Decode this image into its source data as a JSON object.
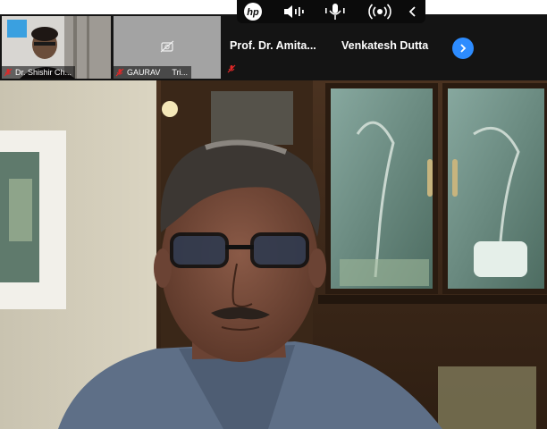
{
  "hp_toolbar": {
    "logo": "hp",
    "buttons": [
      {
        "icon": "speaker-icon"
      },
      {
        "icon": "microphone-icon"
      },
      {
        "icon": "broadcast-icon"
      },
      {
        "icon": "chevron-left-icon"
      }
    ]
  },
  "participants": [
    {
      "name": "Dr. Shishir Ch...",
      "muted": true,
      "video": true
    },
    {
      "name": "GAURAV",
      "subtitle": "Tri...",
      "muted": true,
      "video": false
    },
    {
      "name": "Prof. Dr. Amita...",
      "muted": true,
      "video": false
    },
    {
      "name": "Venkatesh Dutta",
      "muted": false,
      "video": false
    }
  ],
  "strip_next_icon": "chevron-right-icon",
  "colors": {
    "accent": "#2d8cff",
    "muted_red": "#e02828",
    "strip_bg": "#141414"
  }
}
